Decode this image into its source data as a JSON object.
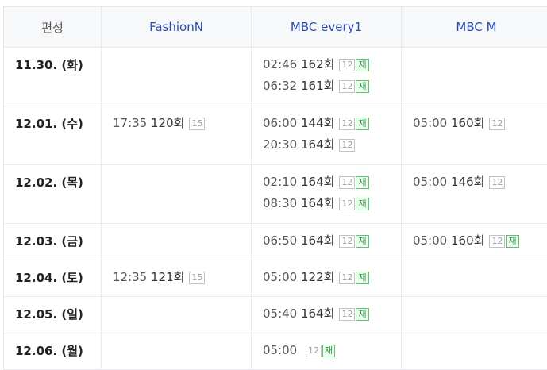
{
  "header": {
    "col0": "편성",
    "col1": "FashionN",
    "col2": "MBC every1",
    "col3": "MBC M"
  },
  "rows": [
    {
      "date": "11.30. (화)",
      "fashionn": [],
      "every1": [
        {
          "time": "02:46",
          "ep": "162회",
          "rating": "12",
          "re": "재"
        },
        {
          "time": "06:32",
          "ep": "161회",
          "rating": "12",
          "re": "재"
        }
      ],
      "mbcm": []
    },
    {
      "date": "12.01. (수)",
      "fashionn": [
        {
          "time": "17:35",
          "ep": "120회",
          "rating": "15",
          "re": ""
        }
      ],
      "every1": [
        {
          "time": "06:00",
          "ep": "144회",
          "rating": "12",
          "re": "재"
        },
        {
          "time": "20:30",
          "ep": "164회",
          "rating": "12",
          "re": ""
        }
      ],
      "mbcm": [
        {
          "time": "05:00",
          "ep": "160회",
          "rating": "12",
          "re": ""
        }
      ]
    },
    {
      "date": "12.02. (목)",
      "fashionn": [],
      "every1": [
        {
          "time": "02:10",
          "ep": "164회",
          "rating": "12",
          "re": "재"
        },
        {
          "time": "08:30",
          "ep": "164회",
          "rating": "12",
          "re": "재"
        }
      ],
      "mbcm": [
        {
          "time": "05:00",
          "ep": "146회",
          "rating": "12",
          "re": ""
        }
      ]
    },
    {
      "date": "12.03. (금)",
      "fashionn": [],
      "every1": [
        {
          "time": "06:50",
          "ep": "164회",
          "rating": "12",
          "re": "재"
        }
      ],
      "mbcm": [
        {
          "time": "05:00",
          "ep": "160회",
          "rating": "12",
          "re": "재"
        }
      ]
    },
    {
      "date": "12.04. (토)",
      "fashionn": [
        {
          "time": "12:35",
          "ep": "121회",
          "rating": "15",
          "re": ""
        }
      ],
      "every1": [
        {
          "time": "05:00",
          "ep": "122회",
          "rating": "12",
          "re": "재"
        }
      ],
      "mbcm": []
    },
    {
      "date": "12.05. (일)",
      "fashionn": [],
      "every1": [
        {
          "time": "05:40",
          "ep": "164회",
          "rating": "12",
          "re": "재"
        }
      ],
      "mbcm": []
    },
    {
      "date": "12.06. (월)",
      "fashionn": [],
      "every1": [
        {
          "time": "05:00",
          "ep": "",
          "rating": "12",
          "re": "재"
        }
      ],
      "mbcm": []
    }
  ]
}
